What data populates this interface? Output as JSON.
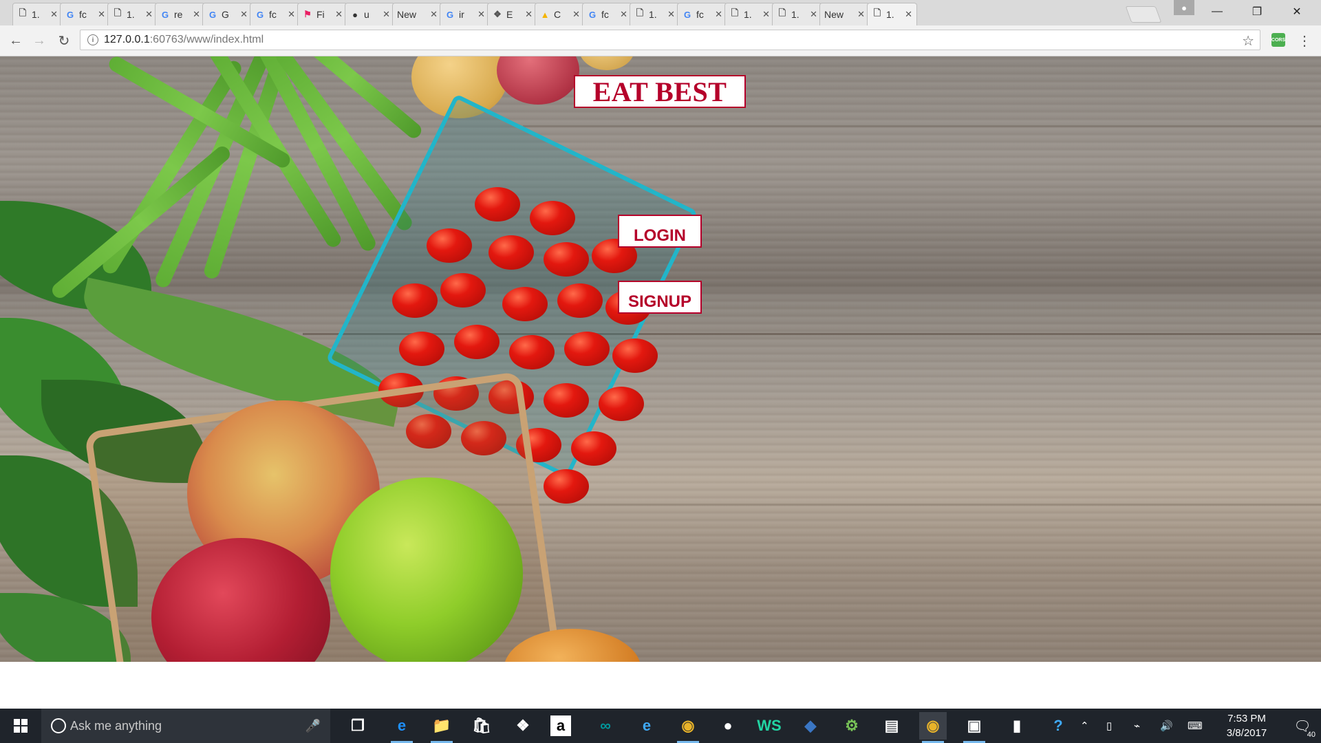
{
  "browser": {
    "tabs": [
      {
        "label": "1.",
        "icon": "doc"
      },
      {
        "label": "fc",
        "icon": "google"
      },
      {
        "label": "1.",
        "icon": "doc"
      },
      {
        "label": "re",
        "icon": "google"
      },
      {
        "label": "G",
        "icon": "google"
      },
      {
        "label": "fc",
        "icon": "google"
      },
      {
        "label": "Fi",
        "icon": "flag"
      },
      {
        "label": "u",
        "icon": "github"
      },
      {
        "label": "New",
        "icon": "none"
      },
      {
        "label": "ir",
        "icon": "google"
      },
      {
        "label": "E",
        "icon": "puzzle"
      },
      {
        "label": "C",
        "icon": "drive"
      },
      {
        "label": "fc",
        "icon": "google"
      },
      {
        "label": "1.",
        "icon": "doc"
      },
      {
        "label": "fc",
        "icon": "google"
      },
      {
        "label": "1.",
        "icon": "doc"
      },
      {
        "label": "1.",
        "icon": "doc"
      },
      {
        "label": "New",
        "icon": "none"
      },
      {
        "label": "1.",
        "icon": "doc",
        "active": true
      }
    ],
    "url_host": "127.0.0.1",
    "url_rest": ":60763/www/index.html",
    "extension_label": "CORS"
  },
  "page": {
    "title": "EAT BEST",
    "login_label": "LOGIN",
    "signup_label": "SIGNUP",
    "accent_color": "#b5002a"
  },
  "taskbar": {
    "search_placeholder": "Ask me anything",
    "apps": [
      "task-view",
      "edge",
      "file-explorer",
      "store",
      "dropbox",
      "amazon",
      "arduino",
      "internet-explorer",
      "chrome",
      "github",
      "webstorm",
      "visual-studio",
      "android-studio",
      "notepad",
      "chrome",
      "unity",
      "terminal",
      "help"
    ],
    "time": "7:53 PM",
    "date": "3/8/2017",
    "notification_count": "40"
  }
}
